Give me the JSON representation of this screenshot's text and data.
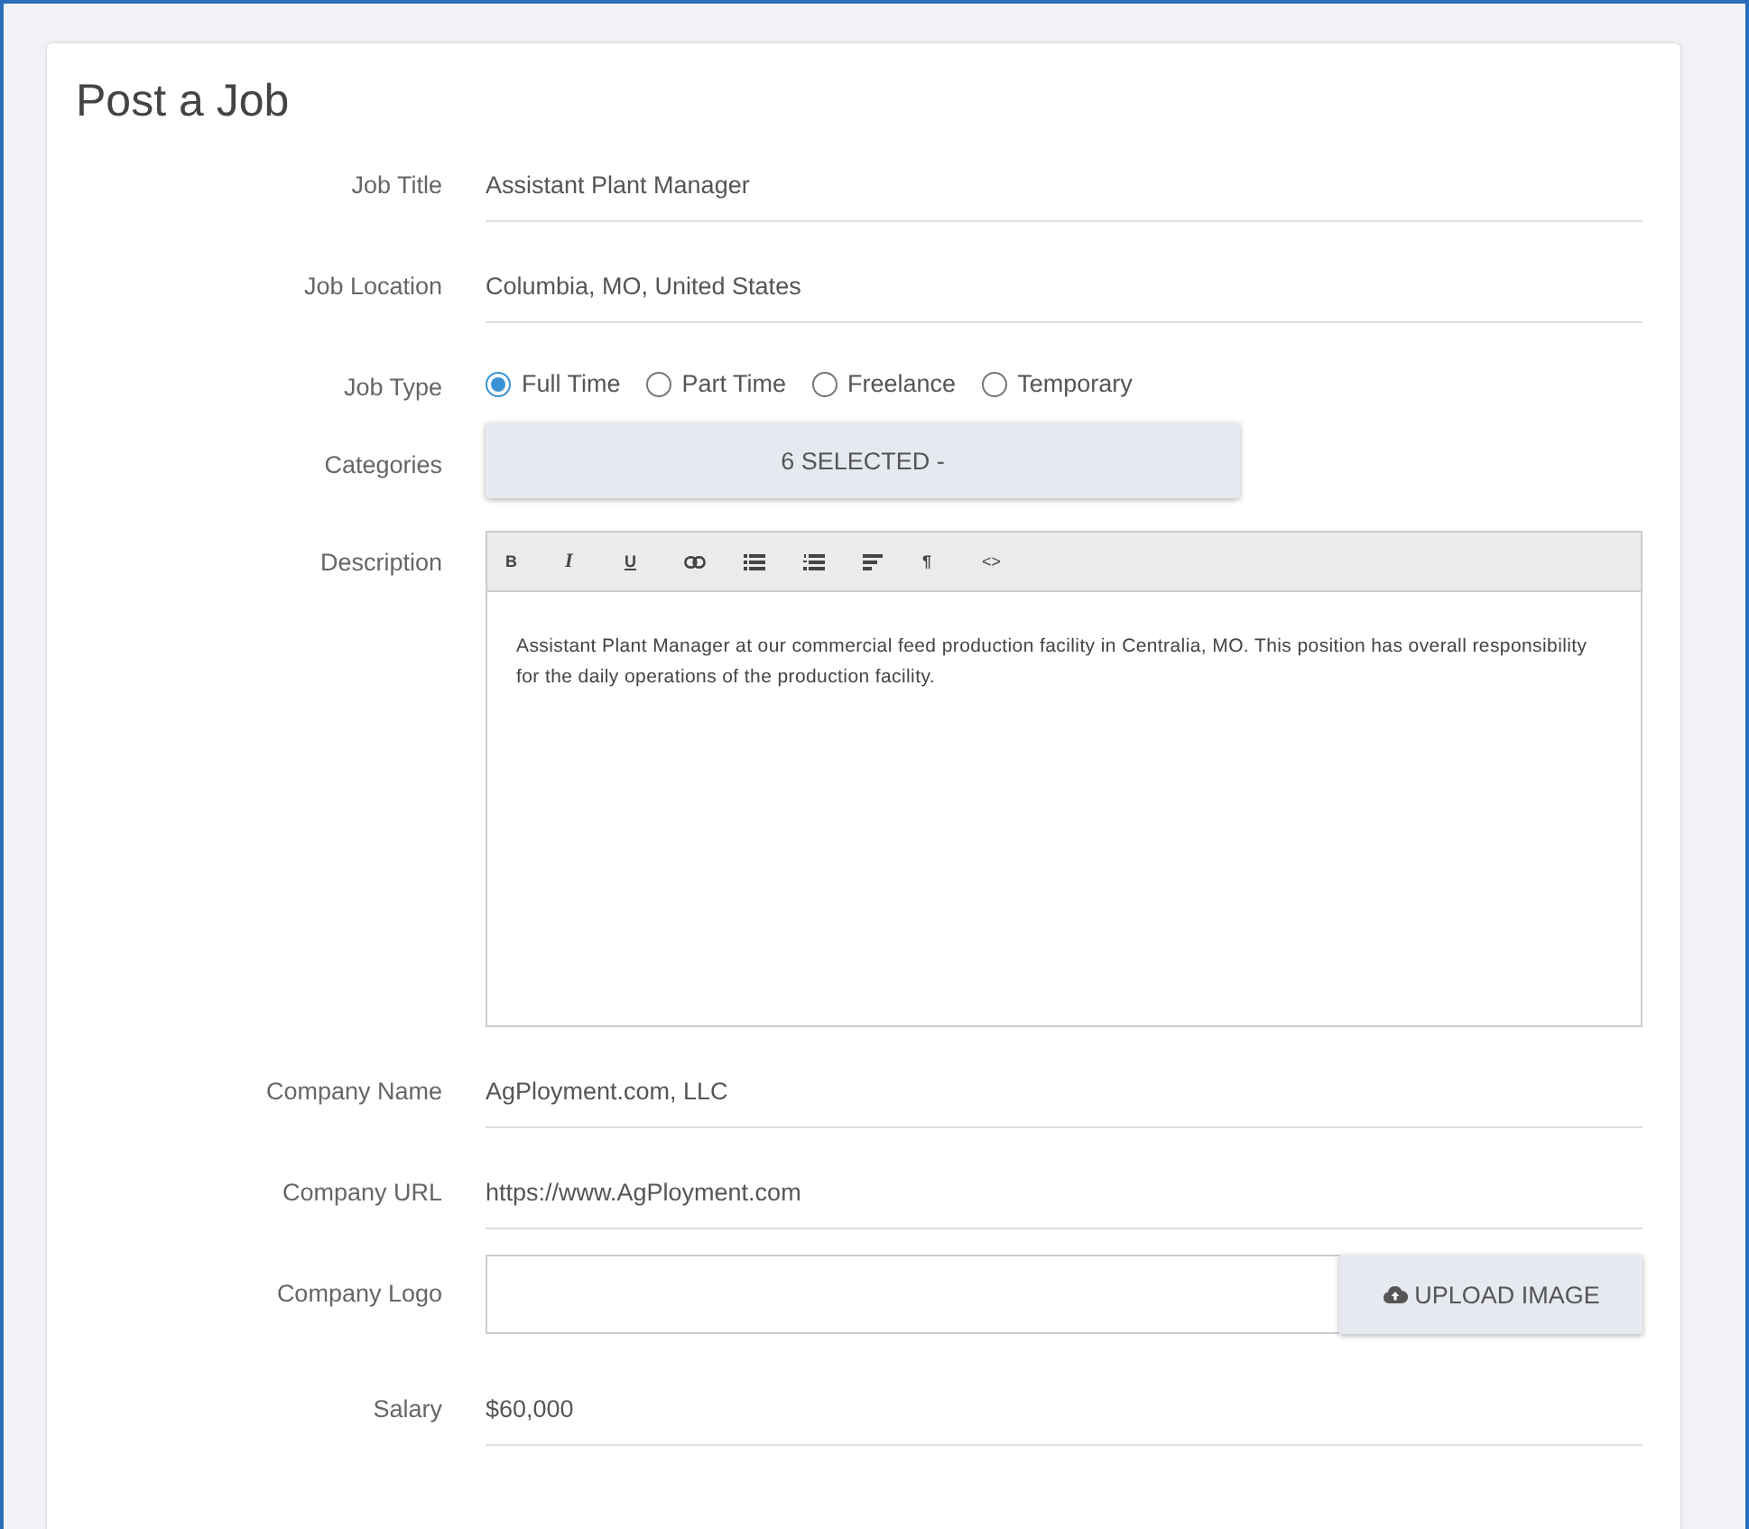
{
  "title": "Post a Job",
  "fields": [
    {
      "kind": "text",
      "label": "Job Title",
      "value": "Assistant Plant Manager"
    },
    {
      "kind": "text",
      "label": "Job Location",
      "value": "Columbia, MO, United States"
    },
    {
      "kind": "radio",
      "label": "Job Type",
      "options": [
        {
          "label": "Full Time",
          "selected": true
        },
        {
          "label": "Part Time",
          "selected": false
        },
        {
          "label": "Freelance",
          "selected": false
        },
        {
          "label": "Temporary",
          "selected": false
        }
      ]
    },
    {
      "kind": "dropdown",
      "label": "Categories",
      "value": "6 SELECTED -"
    },
    {
      "kind": "editor",
      "label": "Description",
      "toolbar": [
        {
          "kind": "bold",
          "label": "B"
        },
        {
          "kind": "italic",
          "label": "I"
        },
        {
          "kind": "underline",
          "label": "U"
        },
        {
          "kind": "link"
        },
        {
          "kind": "bullets"
        },
        {
          "kind": "numbers"
        },
        {
          "kind": "align"
        },
        {
          "kind": "paragraph",
          "label": "¶"
        },
        {
          "kind": "code",
          "label": "<>"
        }
      ],
      "value": "Assistant Plant Manager at our commercial feed production facility in Centralia, MO. This position has overall responsibility for the daily operations of the production facility."
    },
    {
      "kind": "text",
      "label": "Company Name",
      "value": "AgPloyment.com, LLC"
    },
    {
      "kind": "text",
      "label": "Company URL",
      "value": "https://www.AgPloyment.com"
    },
    {
      "kind": "upload",
      "label": "Company Logo",
      "button": "UPLOAD IMAGE"
    },
    {
      "kind": "text",
      "label": "Salary",
      "value": "$60,000"
    }
  ]
}
